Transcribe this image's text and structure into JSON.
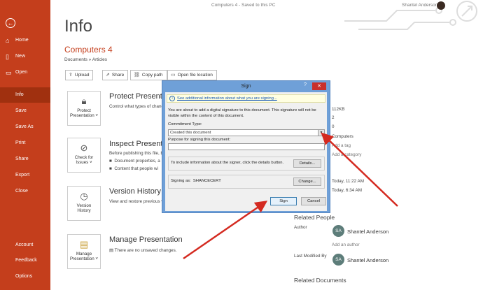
{
  "titlebar": {
    "doc_title": "Computers 4  -  Saved to this PC",
    "user_name": "Shantel Anderson"
  },
  "sidebar": {
    "back_icon": "arrow-left-icon",
    "items": [
      {
        "label": "Home",
        "icon": "home-icon"
      },
      {
        "label": "New",
        "icon": "file-icon"
      },
      {
        "label": "Open",
        "icon": "folder-icon"
      },
      {
        "label": "Info"
      },
      {
        "label": "Save"
      },
      {
        "label": "Save As"
      },
      {
        "label": "Print"
      },
      {
        "label": "Share"
      },
      {
        "label": "Export"
      },
      {
        "label": "Close"
      },
      {
        "label": "Account"
      },
      {
        "label": "Feedback"
      },
      {
        "label": "Options"
      }
    ]
  },
  "main": {
    "heading": "Info",
    "doc_name": "Computers 4",
    "breadcrumb": "Documents » Articles",
    "actions": [
      {
        "label": "Upload",
        "icon": "upload-icon"
      },
      {
        "label": "Share",
        "icon": "share-icon"
      },
      {
        "label": "Copy path",
        "icon": "link-icon"
      },
      {
        "label": "Open file location",
        "icon": "folder-icon"
      }
    ],
    "sections": [
      {
        "button": [
          "Protect",
          "Presentation ˅"
        ],
        "title": "Protect Presentation",
        "desc": "Control what types of chang"
      },
      {
        "button": [
          "Check for",
          "Issues ˅"
        ],
        "title": "Inspect Presentation",
        "desc": "Before publishing this file, b",
        "bullets": [
          "Document properties, a",
          "Content that people wi"
        ]
      },
      {
        "button": [
          "Version",
          "History"
        ],
        "title": "Version History",
        "desc": "View and restore previous ve"
      },
      {
        "button": [
          "Manage",
          "Presentation ˅"
        ],
        "title": "Manage Presentation",
        "desc": "There are no unsaved changes."
      }
    ]
  },
  "properties": {
    "values": [
      "112KB",
      "2",
      "0",
      "Computers"
    ],
    "add_tag": "Add a tag",
    "add_category": "Add a category",
    "dates": [
      "Today, 11:22 AM",
      "Today, 6:34 AM"
    ],
    "related_people_title": "Related People",
    "author_label": "Author",
    "author_initials": "SA",
    "author_name": "Shantel Anderson",
    "add_author": "Add an author",
    "modified_label": "Last Modified By",
    "modified_initials": "SA",
    "modified_name": "Shantel Anderson",
    "related_docs_title": "Related Documents"
  },
  "dialog": {
    "title": "Sign",
    "help": "?",
    "close": "✕",
    "info_link": "See additional information about what you are signing...",
    "body_text": "You are about to add a digital signature to this document. This signature will not be visible within the content of this document.",
    "commitment_label": "Commitment Type:",
    "commitment_value": "Created this document",
    "purpose_label": "Purpose for signing this document:",
    "signer_info_text": "To include information about the signer, click the details button.",
    "details_button": "Details...",
    "signing_as_label": "Signing as:",
    "signing_as_value": "SHANCECERT",
    "change_button": "Change...",
    "sign_button": "Sign",
    "cancel_button": "Cancel"
  },
  "colors": {
    "sidebar": "#c43e1c",
    "sidebar_active": "#a0300f",
    "accent_text": "#c43e1c",
    "dialog_frame": "#6fa0d8",
    "annotation_arrow": "#d42a20"
  }
}
